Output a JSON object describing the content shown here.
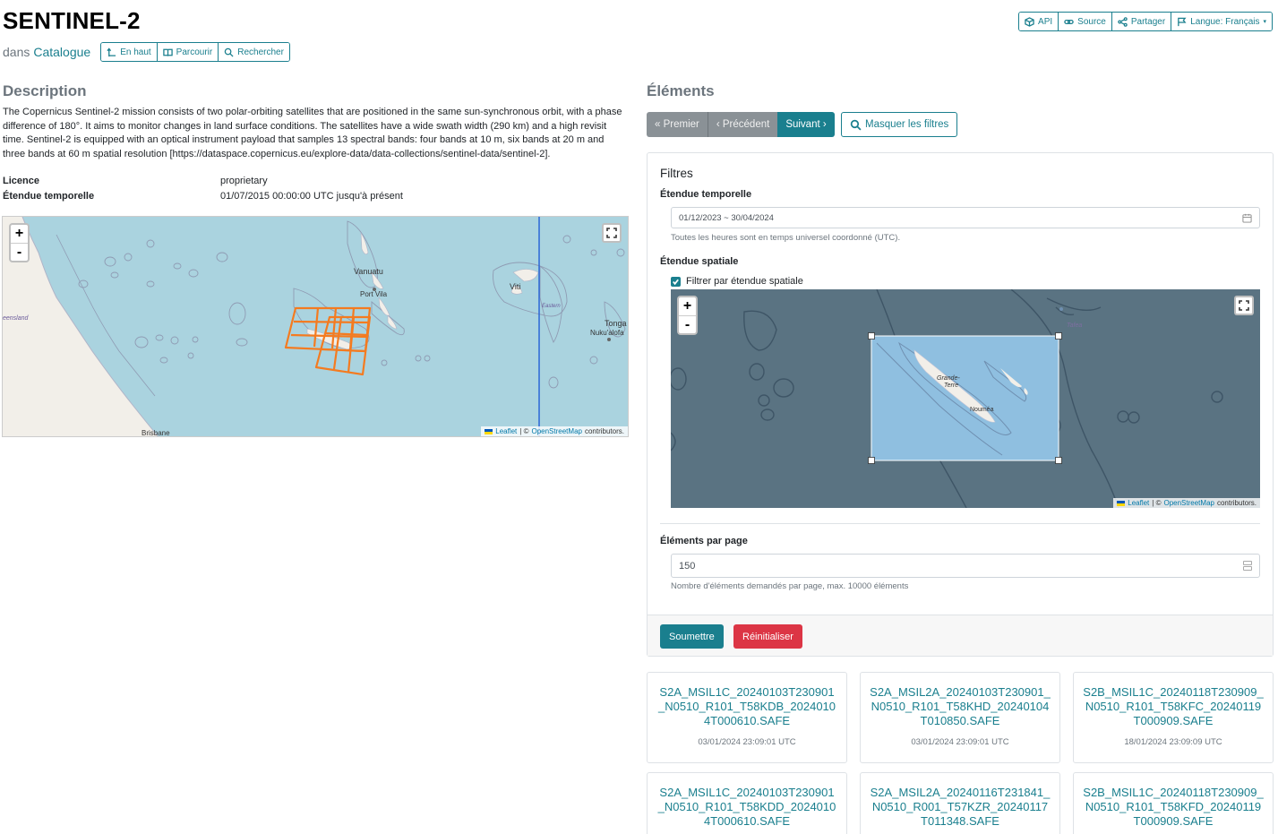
{
  "page": {
    "title": "SENTINEL-2",
    "in_label": "dans",
    "catalog_link": "Catalogue"
  },
  "nav_buttons": {
    "up": "En haut",
    "browse": "Parcourir",
    "search": "Rechercher"
  },
  "top_actions": {
    "api": "API",
    "source": "Source",
    "share": "Partager",
    "language": "Langue: Français"
  },
  "description": {
    "heading": "Description",
    "text": "The Copernicus Sentinel-2 mission consists of two polar-orbiting satellites that are positioned in the same sun-synchronous orbit, with a phase difference of 180°. It aims to monitor changes in land surface conditions. The satellites have a wide swath width (290 km) and a high revisit time. Sentinel-2 is equipped with an optical instrument payload that samples 13 spectral bands: four bands at 10 m, six bands at 20 m and three bands at 60 m spatial resolution [https://dataspace.copernicus.eu/explore-data/data-collections/sentinel-data/sentinel-2]."
  },
  "metadata": [
    {
      "key": "Licence",
      "value": "proprietary"
    },
    {
      "key": "Étendue temporelle",
      "value": "01/07/2015 00:00:00 UTC jusqu'à présent"
    }
  ],
  "map1": {
    "zoom_in": "+",
    "zoom_out": "-",
    "labels": {
      "vanuatu": "Vanuatu",
      "port_vila": "Port Vila",
      "viti": "Viti",
      "eastern": "Eastern",
      "tonga": "Tonga",
      "nukualofa": "Nuku'alofa",
      "queensland": "eensland",
      "brisbane": "Brisbane"
    },
    "attribution": {
      "leaflet": "Leaflet",
      "sep": "| ©",
      "osm": "OpenStreetMap",
      "suffix": "contributors."
    }
  },
  "elements": {
    "heading": "Éléments",
    "first": "« Premier",
    "prev": "‹ Précédent",
    "next": "Suivant ›",
    "hide_filters": "Masquer les filtres"
  },
  "filters": {
    "title": "Filtres",
    "temporal_label": "Étendue temporelle",
    "temporal_value": "01/12/2023 ~ 30/04/2024",
    "temporal_help": "Toutes les heures sont en temps universel coordonné (UTC).",
    "spatial_label": "Étendue spatiale",
    "spatial_checkbox": "Filtrer par étendue spatiale",
    "map_labels": {
      "grande_terre_1": "Grande-",
      "grande_terre_2": "Terre",
      "noumea": "Nouméa",
      "tafea": "Tafea"
    },
    "per_page_label": "Éléments par page",
    "per_page_value": "150",
    "per_page_help": "Nombre d'éléments demandés par page, max. 10000 éléments",
    "submit": "Soumettre",
    "reset": "Réinitialiser"
  },
  "items": [
    {
      "name": "S2A_MSIL1C_20240103T230901_N0510_R101_T58KDB_20240104T000610.SAFE",
      "date": "03/01/2024 23:09:01 UTC"
    },
    {
      "name": "S2A_MSIL2A_20240103T230901_N0510_R101_T58KHD_20240104T010850.SAFE",
      "date": "03/01/2024 23:09:01 UTC"
    },
    {
      "name": "S2B_MSIL1C_20240118T230909_N0510_R101_T58KFC_20240119T000909.SAFE",
      "date": "18/01/2024 23:09:09 UTC"
    },
    {
      "name": "S2A_MSIL1C_20240103T230901_N0510_R101_T58KDD_20240104T000610.SAFE",
      "date": ""
    },
    {
      "name": "S2A_MSIL2A_20240116T231841_N0510_R001_T57KZR_20240117T011348.SAFE",
      "date": ""
    },
    {
      "name": "S2B_MSIL1C_20240118T230909_N0510_R101_T58KFD_20240119T000909.SAFE",
      "date": ""
    }
  ],
  "colors": {
    "accent": "#1a7f8e",
    "danger": "#dc3545",
    "footprint": "#f47b20",
    "water": "#aad3df"
  }
}
